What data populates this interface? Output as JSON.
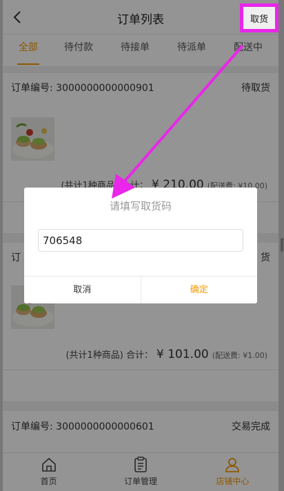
{
  "header": {
    "title": "订单列表",
    "pickup_label": "取货"
  },
  "tabs": [
    {
      "label": "全部",
      "active": true
    },
    {
      "label": "待付款",
      "active": false
    },
    {
      "label": "待接单",
      "active": false
    },
    {
      "label": "待派单",
      "active": false
    },
    {
      "label": "配送中",
      "active": false
    }
  ],
  "orders": [
    {
      "number_label": "订单编号: 3000000000000901",
      "status": "待取货",
      "summary_count": "(共计1种商品) 合计：",
      "summary_amount": "¥ 210.00",
      "summary_fee": "(配送费: ¥10.00)"
    },
    {
      "number_label": "订",
      "status": "货",
      "summary_count": "(共计1种商品) 合计：",
      "summary_amount": "¥  101.00",
      "summary_fee": "(配送费: ¥1.00)"
    },
    {
      "number_label": "订单编号: 3000000000000601",
      "status": "交易完成"
    }
  ],
  "dialog": {
    "title": "请填写取货码",
    "input_value": "706548",
    "cancel_label": "取消",
    "confirm_label": "确定"
  },
  "bottom_nav": [
    {
      "label": "首页",
      "icon": "home-icon",
      "active": false
    },
    {
      "label": "订单管理",
      "icon": "clipboard-icon",
      "active": false
    },
    {
      "label": "店铺中心",
      "icon": "user-icon",
      "active": true
    }
  ],
  "colors": {
    "accent": "#f39800",
    "annotation": "#e926e9"
  }
}
